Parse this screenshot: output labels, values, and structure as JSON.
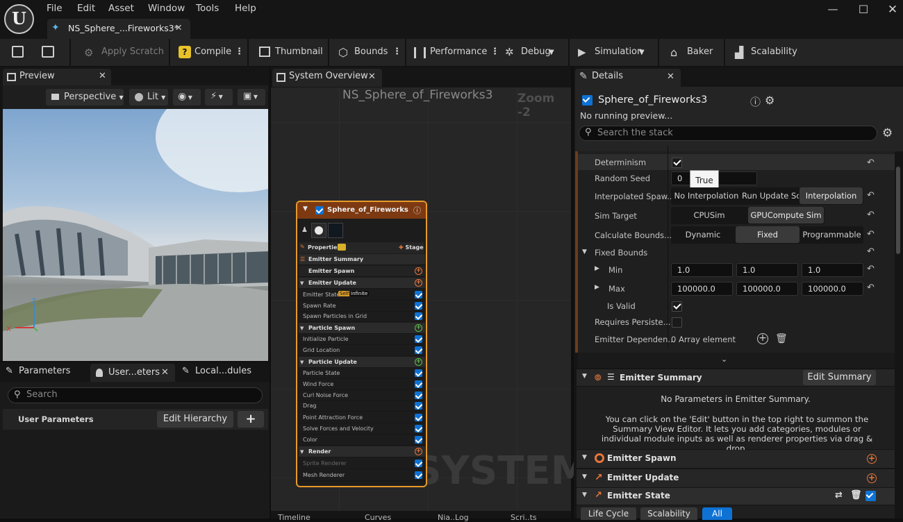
{
  "menu": [
    "File",
    "Edit",
    "Asset",
    "Window",
    "Tools",
    "Help"
  ],
  "doc_tab": "NS_Sphere_...Fireworks3*",
  "toolbar": {
    "apply_scratch": "Apply Scratch",
    "compile": "Compile",
    "thumbnail": "Thumbnail",
    "bounds": "Bounds",
    "performance": "Performance",
    "debug": "Debug",
    "simulation": "Simulation",
    "baker": "Baker",
    "scalability": "Scalability"
  },
  "preview": {
    "tab": "Preview",
    "perspective": "Perspective",
    "lit": "Lit"
  },
  "params": {
    "tabs": [
      "Parameters",
      "User...eters",
      "Local...dules"
    ],
    "search": "Search",
    "user_params": "User Parameters",
    "edit_hierarchy": "Edit Hierarchy"
  },
  "system": {
    "tab": "System Overview",
    "title": "NS_Sphere_of_Fireworks3",
    "zoom": "Zoom -2",
    "watermark": "SYSTEM",
    "bottom_tabs": [
      "Timeline",
      "Curves",
      "Nia..Log",
      "Scri..ts"
    ]
  },
  "node": {
    "title": "Sphere_of_Fireworks",
    "properties": "Properties",
    "stage": "Stage",
    "rows": [
      {
        "label": "Emitter Summary",
        "type": "head"
      },
      {
        "label": "Emitter Spawn",
        "type": "subhead"
      },
      {
        "label": "Emitter Update",
        "type": "head"
      },
      {
        "label": "Emitter State",
        "type": "item",
        "badges": [
          "Self",
          "Infinite"
        ]
      },
      {
        "label": "Spawn Rate",
        "type": "item"
      },
      {
        "label": "Spawn Particles in Grid",
        "type": "item"
      },
      {
        "label": "Particle Spawn",
        "type": "head"
      },
      {
        "label": "Initialize Particle",
        "type": "item"
      },
      {
        "label": "Grid Location",
        "type": "item"
      },
      {
        "label": "Particle Update",
        "type": "head"
      },
      {
        "label": "Particle State",
        "type": "item"
      },
      {
        "label": "Wind Force",
        "type": "item"
      },
      {
        "label": "Curl Noise Force",
        "type": "item"
      },
      {
        "label": "Drag",
        "type": "item"
      },
      {
        "label": "Point Attraction Force",
        "type": "item"
      },
      {
        "label": "Solve Forces and Velocity",
        "type": "item"
      },
      {
        "label": "Color",
        "type": "item"
      },
      {
        "label": "Render",
        "type": "head"
      },
      {
        "label": "Sprite Renderer",
        "type": "item"
      },
      {
        "label": "Mesh Renderer",
        "type": "item"
      }
    ]
  },
  "details": {
    "tab": "Details",
    "name": "Sphere_of_Fireworks3",
    "status": "No running preview...",
    "search": "Search the stack",
    "determinism": "Determinism",
    "random_seed": "Random Seed",
    "seed_value": "0",
    "tooltip": "True",
    "interp_label": "Interpolated Spaw...",
    "interp_opts": [
      "No Interpolation",
      "Run Update Scri",
      "Interpolation"
    ],
    "sim_target": "Sim Target",
    "sim_opts": [
      "CPUSim",
      "GPUCompute Sim"
    ],
    "calc_bounds": "Calculate Bounds...",
    "bounds_opts": [
      "Dynamic",
      "Fixed",
      "Programmable"
    ],
    "fixed_bounds": "Fixed Bounds",
    "min": "Min",
    "min_vals": [
      "1.0",
      "1.0",
      "1.0"
    ],
    "max": "Max",
    "max_vals": [
      "100000.0",
      "100000.0",
      "100000.0"
    ],
    "is_valid": "Is Valid",
    "requires": "Requires Persiste...",
    "emitter_dep": "Emitter Dependen...",
    "array_el": "0 Array element",
    "emitter_summary": "Emitter Summary",
    "edit_summary": "Edit Summary",
    "no_params": "No Parameters in Emitter Summary.",
    "help_text": "You can click on the 'Edit' button in the top right to summon the Summary View Editor. It lets you add categories, modules or individual module inputs as well as renderer properties via drag & drop.",
    "emitter_spawn": "Emitter Spawn",
    "emitter_update": "Emitter Update",
    "emitter_state": "Emitter State",
    "state_tabs": [
      "Life Cycle",
      "Scalability",
      "All"
    ]
  }
}
